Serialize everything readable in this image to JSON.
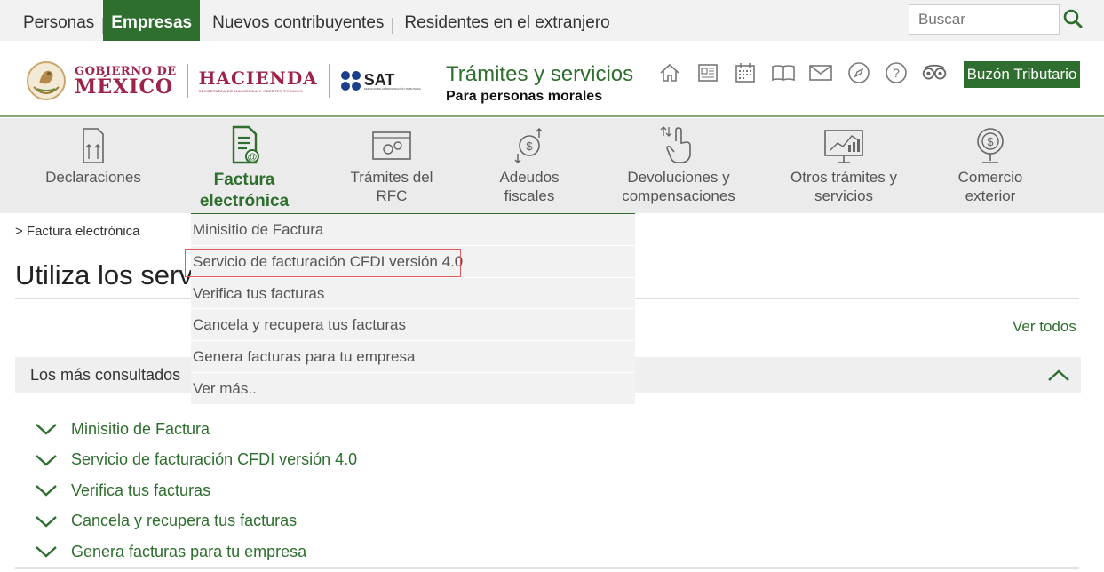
{
  "topnav": {
    "items": [
      {
        "label": "Personas"
      },
      {
        "label": "Empresas"
      },
      {
        "label": "Nuevos contribuyentes"
      },
      {
        "label": "Residentes en el extranjero"
      }
    ],
    "search_placeholder": "Buscar"
  },
  "header": {
    "gob_line1": "GOBIERNO DE",
    "gob_line2": "MÉXICO",
    "hacienda": "HACIENDA",
    "hacienda_sub": "SECRETARÍA DE HACIENDA Y CRÉDITO PÚBLICO",
    "sat": "SAT",
    "sat_sub": "SERVICIO DE ADMINISTRACIÓN TRIBUTARIA",
    "title": "Trámites y servicios",
    "subtitle": "Para personas morales",
    "buzon": "Buzón Tributario",
    "icons": [
      "home-icon",
      "newspaper-icon",
      "calendar-icon",
      "book-icon",
      "mail-icon",
      "compass-icon",
      "help-icon",
      "tax-assistant-icon"
    ]
  },
  "mainnav": {
    "items": [
      {
        "label": "Declaraciones",
        "icon": "declaraciones-icon"
      },
      {
        "label": "Factura electrónica",
        "icon": "factura-icon"
      },
      {
        "label": "Trámites del RFC",
        "icon": "rfc-icon"
      },
      {
        "label": "Adeudos fiscales",
        "icon": "adeudos-icon"
      },
      {
        "label": "Devoluciones y compensaciones",
        "icon": "devoluciones-icon"
      },
      {
        "label": "Otros trámites y servicios",
        "icon": "otros-tramites-icon"
      },
      {
        "label": "Comercio exterior",
        "icon": "comercio-exterior-icon"
      }
    ]
  },
  "dropdown": {
    "items": [
      {
        "label": "Minisitio de Factura"
      },
      {
        "label": "Servicio de facturación CFDI versión 4.0"
      },
      {
        "label": "Verifica tus facturas"
      },
      {
        "label": "Cancela y recupera tus facturas"
      },
      {
        "label": "Genera facturas para tu empresa"
      },
      {
        "label": "Ver más.."
      }
    ]
  },
  "page": {
    "breadcrumb": "> Factura electrónica",
    "title": "Utiliza los servi",
    "ver_todos": "Ver todos",
    "accordion_title": "Los más consultados",
    "list": [
      {
        "label": "Minisitio de Factura"
      },
      {
        "label": "Servicio de facturación CFDI versión 4.0"
      },
      {
        "label": "Verifica tus facturas"
      },
      {
        "label": "Cancela y recupera tus facturas"
      },
      {
        "label": "Genera facturas para tu empresa"
      }
    ]
  },
  "colors": {
    "brand_green": "#2e6e2e",
    "gob_red": "#9d2449",
    "highlight_red": "#e05a5a"
  }
}
